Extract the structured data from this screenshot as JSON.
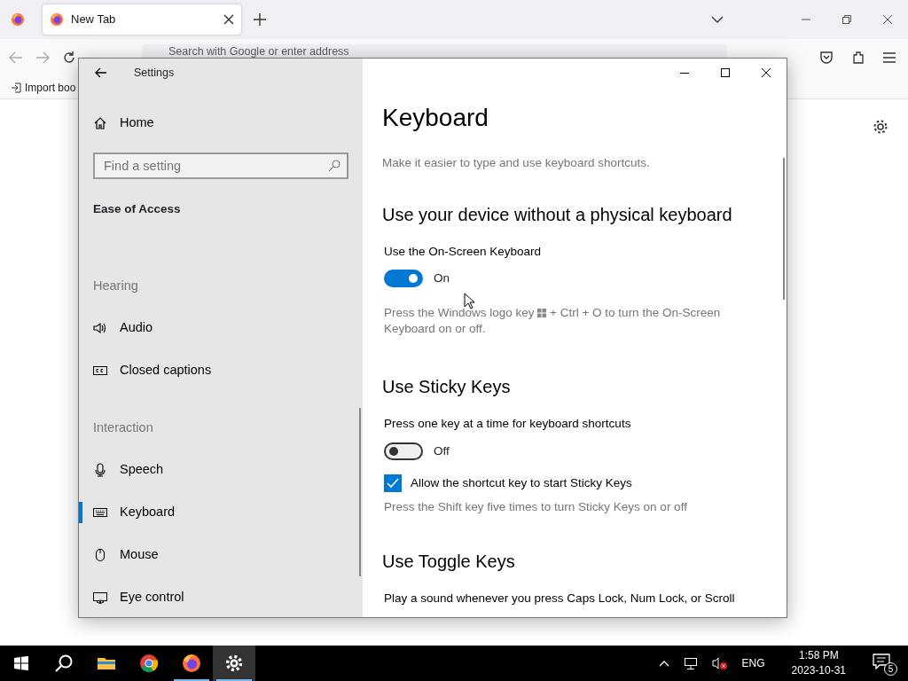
{
  "browser": {
    "tabs": [
      {
        "label": "New Tab",
        "selected": true
      }
    ],
    "address_placeholder": "Search with Google or enter address",
    "bookmarks": [
      "Import boo"
    ]
  },
  "settings": {
    "title": "Settings",
    "home": "Home",
    "search_placeholder": "Find a setting",
    "category": "Ease of Access",
    "groups": [
      {
        "heading": "Hearing",
        "items": [
          {
            "label": "Audio",
            "selected": false
          },
          {
            "label": "Closed captions",
            "selected": false
          }
        ]
      },
      {
        "heading": "Interaction",
        "items": [
          {
            "label": "Speech",
            "selected": false
          },
          {
            "label": "Keyboard",
            "selected": true
          },
          {
            "label": "Mouse",
            "selected": false
          },
          {
            "label": "Eye control",
            "selected": false
          }
        ]
      }
    ],
    "page": {
      "title": "Keyboard",
      "subtitle": "Make it easier to type and use keyboard shortcuts.",
      "sections": [
        {
          "heading": "Use your device without a physical keyboard",
          "settings": [
            {
              "kind": "toggle",
              "label": "Use the On-Screen Keyboard",
              "on": true,
              "state_text": "On",
              "note_before": "Press the Windows logo key",
              "note_after": "+ Ctrl + O to turn the On-Screen Keyboard on or off."
            }
          ]
        },
        {
          "heading": "Use Sticky Keys",
          "settings": [
            {
              "kind": "toggle",
              "label": "Press one key at a time for keyboard shortcuts",
              "on": false,
              "state_text": "Off"
            },
            {
              "kind": "checkbox",
              "label": "Allow the shortcut key to start Sticky Keys",
              "checked": true,
              "note_after": "Press the Shift key five times to turn Sticky Keys on or off"
            }
          ]
        },
        {
          "heading": "Use Toggle Keys",
          "settings": [
            {
              "kind": "text",
              "label": "Play a sound whenever you press Caps Lock, Num Lock, or Scroll"
            }
          ]
        }
      ]
    }
  },
  "taskbar": {
    "apps": [
      {
        "kind": "folder",
        "running": false,
        "selected": false
      },
      {
        "kind": "chrome",
        "running": false,
        "selected": false
      },
      {
        "kind": "firefox",
        "running": true,
        "selected": false
      },
      {
        "kind": "gear",
        "running": true,
        "selected": true
      }
    ],
    "language": "ENG",
    "time": "1:58 PM",
    "date": "2023-10-31",
    "notifications": "5"
  }
}
